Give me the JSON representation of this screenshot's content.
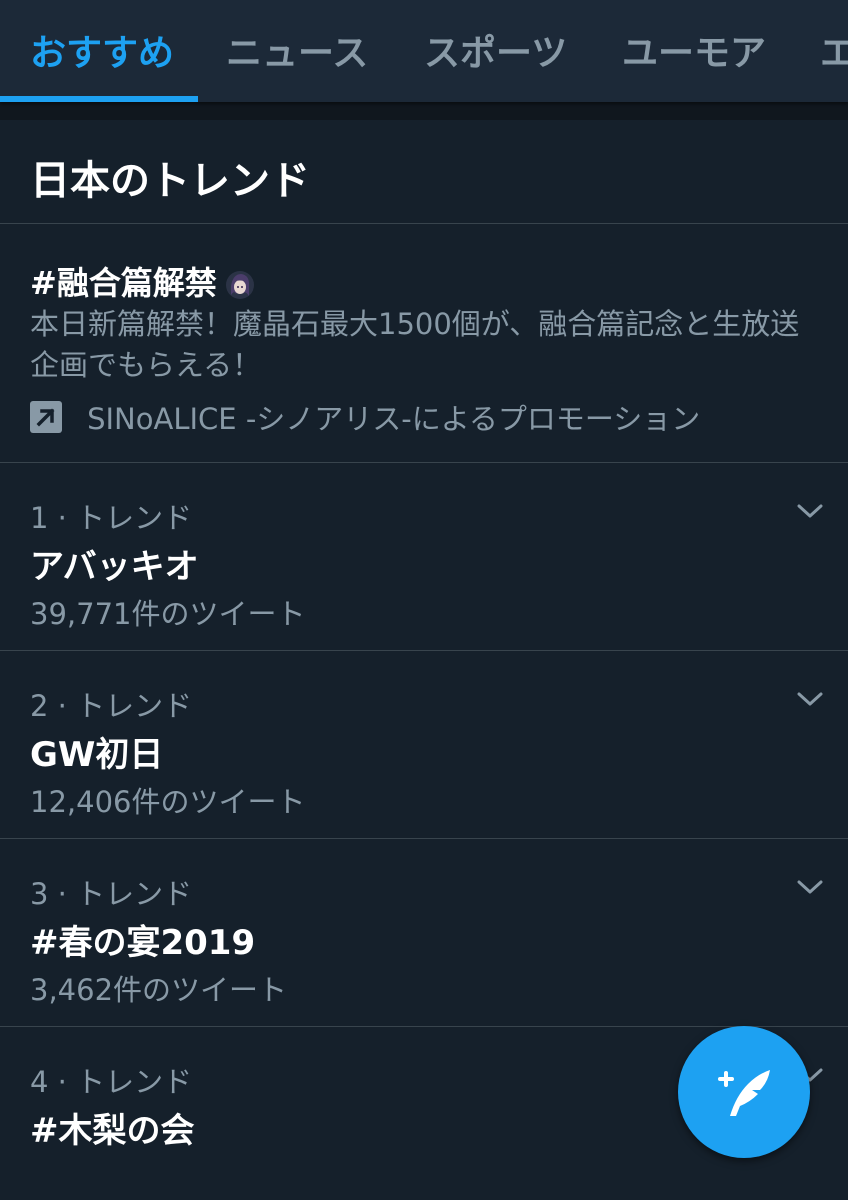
{
  "tabs": [
    {
      "label": "おすすめ",
      "active": true
    },
    {
      "label": "ニュース",
      "active": false
    },
    {
      "label": "スポーツ",
      "active": false
    },
    {
      "label": "ユーモア",
      "active": false
    },
    {
      "label": "エ",
      "active": false
    }
  ],
  "section": {
    "title": "日本のトレンド"
  },
  "promoted": {
    "title": "#融合篇解禁",
    "description": "本日新篇解禁！魔晶石最大1500個が、融合篇記念と生放送企画でもらえる！",
    "promoted_by": "SINoALICE -シノアリス-によるプロモーション",
    "icon": "promoted-arrow-icon"
  },
  "trends": [
    {
      "meta": "1 · トレンド",
      "name": "アバッキオ",
      "count": "39,771件のツイート"
    },
    {
      "meta": "2 · トレンド",
      "name": "GW初日",
      "count": "12,406件のツイート"
    },
    {
      "meta": "3 · トレンド",
      "name": "#春の宴2019",
      "count": "3,462件のツイート"
    },
    {
      "meta": "4 · トレンド",
      "name": "#木梨の会",
      "count": ""
    }
  ],
  "fab": {
    "icon": "compose-tweet-icon"
  },
  "colors": {
    "background": "#15202b",
    "header": "#1c2938",
    "accent": "#1da1f2",
    "secondary_text": "#8899a6",
    "divider": "#38444d"
  }
}
